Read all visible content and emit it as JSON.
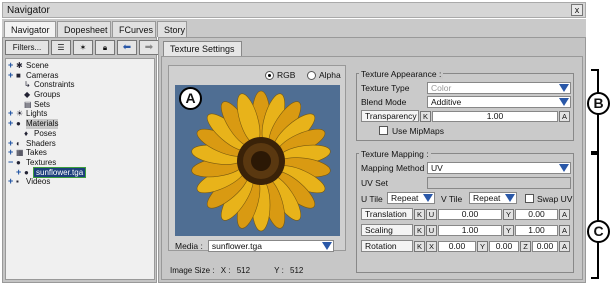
{
  "window": {
    "title": "Navigator",
    "close": "x"
  },
  "tabs": [
    "Navigator",
    "Dopesheet",
    "FCurves",
    "Story"
  ],
  "left": {
    "filters": "Filters...",
    "tree": [
      {
        "pm": "+",
        "icon": "✱",
        "label": "Scene"
      },
      {
        "pm": "+",
        "icon": "■",
        "label": "Cameras"
      },
      {
        "pm": "",
        "icon": "↳",
        "label": "Constraints"
      },
      {
        "pm": "",
        "icon": "◆",
        "label": "Groups"
      },
      {
        "pm": "",
        "icon": "▤",
        "label": "Sets"
      },
      {
        "pm": "+",
        "icon": "☀",
        "label": "Lights"
      },
      {
        "pm": "+",
        "icon": "●",
        "label": "Materials"
      },
      {
        "pm": "",
        "icon": "♦",
        "label": "Poses"
      },
      {
        "pm": "+",
        "icon": "◐",
        "label": "Shaders"
      },
      {
        "pm": "+",
        "icon": "▦",
        "label": "Takes"
      },
      {
        "pm": "−",
        "icon": "●",
        "label": "Textures"
      },
      {
        "pm": "+",
        "icon": "●",
        "label": "sunflower.tga"
      },
      {
        "pm": "+",
        "icon": "▪",
        "label": "Videos"
      }
    ]
  },
  "right": {
    "subtab": "Texture Settings",
    "rgb": "RGB",
    "alpha": "Alpha",
    "media_label": "Media :",
    "media_value": "sunflower.tga",
    "image_size": {
      "label": "Image Size :",
      "x_label": "X :",
      "x": "512",
      "y_label": "Y :",
      "y": "512"
    },
    "appearance": {
      "title": "Texture Appearance :",
      "type_label": "Texture Type",
      "type_value": "Color",
      "blend_label": "Blend Mode",
      "blend_value": "Additive",
      "transparency_label": "Transparency",
      "k": "K",
      "transparency_value": "1.00",
      "a": "A",
      "mipmaps": "Use MipMaps"
    },
    "mapping": {
      "title": "Texture Mapping :",
      "method_label": "Mapping Method",
      "method_value": "UV",
      "uvset_label": "UV Set",
      "utile_label": "U Tile",
      "utile_value": "Repeat",
      "vtile_label": "V Tile",
      "vtile_value": "Repeat",
      "swap": "Swap UV",
      "translation_label": "Translation",
      "u": "U",
      "y": "Y",
      "translation_u": "0.00",
      "translation_y": "0.00",
      "scaling_label": "Scaling",
      "scaling_u": "1.00",
      "scaling_y": "1.00",
      "rotation_label": "Rotation",
      "x": "X",
      "z": "Z",
      "rotation_x": "0.00",
      "rotation_y": "0.00",
      "rotation_z": "0.00"
    }
  },
  "callouts": {
    "a": "A",
    "b": "B",
    "c": "C"
  },
  "colors": {
    "petal": "#e8b31a",
    "center": "#3a2208",
    "sky": "#4f6e93",
    "selection": "#1c3f7c"
  }
}
